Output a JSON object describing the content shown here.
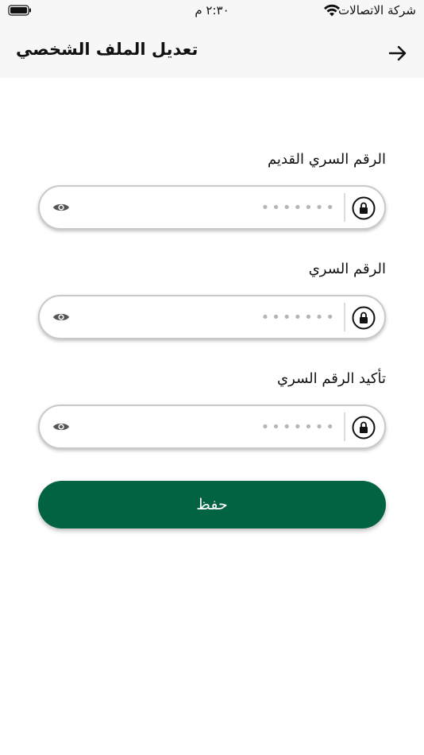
{
  "status_bar": {
    "carrier": "شركة الاتصالات",
    "time": "٢:٣٠ م"
  },
  "header": {
    "title": "تعديل الملف الشخصي",
    "back_icon": "arrow-right-icon"
  },
  "form": {
    "fields": [
      {
        "label": "الرقم السري القديم",
        "placeholder": "•••••••"
      },
      {
        "label": "الرقم السري",
        "placeholder": "•••••••"
      },
      {
        "label": "تأكيد الرقم السري",
        "placeholder": "•••••••"
      }
    ],
    "lock_icon": "lock-icon",
    "eye_icon": "eye-icon",
    "save_label": "حفظ"
  },
  "colors": {
    "primary": "#026342",
    "header_bg": "#f7f7f7",
    "border": "#c9c9c9"
  }
}
